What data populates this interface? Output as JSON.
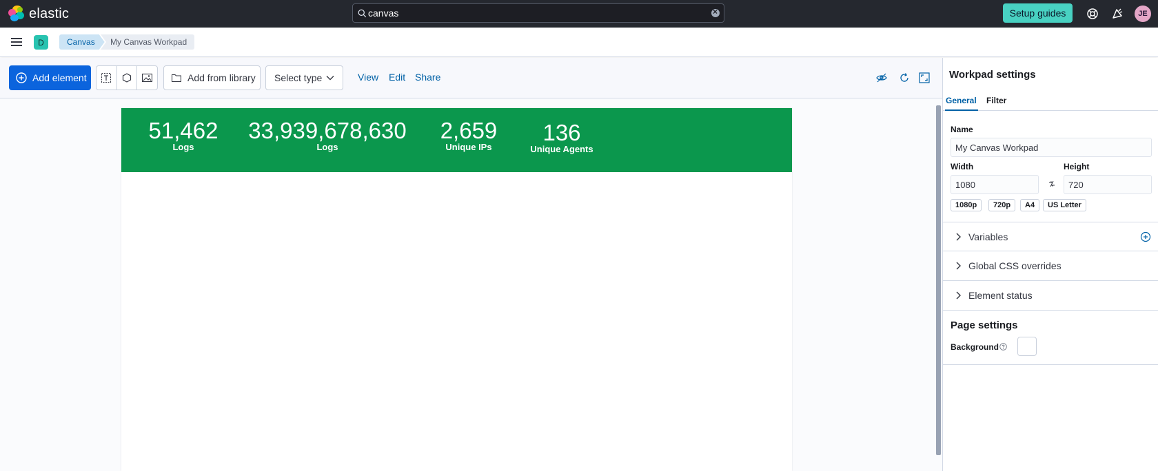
{
  "header": {
    "brand": "elastic",
    "search": {
      "value": "canvas",
      "placeholder": ""
    },
    "setup_guides_label": "Setup guides",
    "avatar_initials": "JE",
    "colors": {
      "bar": "#25282f",
      "setup_button": "#48d1c2",
      "avatar": "#e4a6c7"
    }
  },
  "subbar": {
    "space_initial": "D",
    "breadcrumbs": [
      "Canvas",
      "My Canvas Workpad"
    ]
  },
  "toolbar": {
    "add_element_label": "Add element",
    "add_from_library_label": "Add from library",
    "select_type_label": "Select type",
    "view_label": "View",
    "edit_label": "Edit",
    "share_label": "Share",
    "icons": [
      "text-icon",
      "shape-icon",
      "image-icon",
      "eye-closed-icon",
      "refresh-icon",
      "fullscreen-icon"
    ]
  },
  "workpad": {
    "band_color": "#0b974d",
    "metrics": [
      {
        "value": "51,462",
        "label": "Logs"
      },
      {
        "value": "33,939,678,630",
        "label": "Logs"
      },
      {
        "value": "2,659",
        "label": "Unique IPs"
      },
      {
        "value": "136",
        "label": "Unique Agents"
      }
    ]
  },
  "sidebar": {
    "title": "Workpad settings",
    "tabs": [
      {
        "label": "General",
        "active": true
      },
      {
        "label": "Filter",
        "active": false
      }
    ],
    "name_label": "Name",
    "name_value": "My Canvas Workpad",
    "width_label": "Width",
    "width_value": "1080",
    "height_label": "Height",
    "height_value": "720",
    "presets": [
      "1080p",
      "720p",
      "A4",
      "US Letter"
    ],
    "accordions": [
      "Variables",
      "Global CSS overrides",
      "Element status"
    ],
    "page_settings_title": "Page settings",
    "background_label": "Background",
    "background_color": "#ffffff"
  }
}
